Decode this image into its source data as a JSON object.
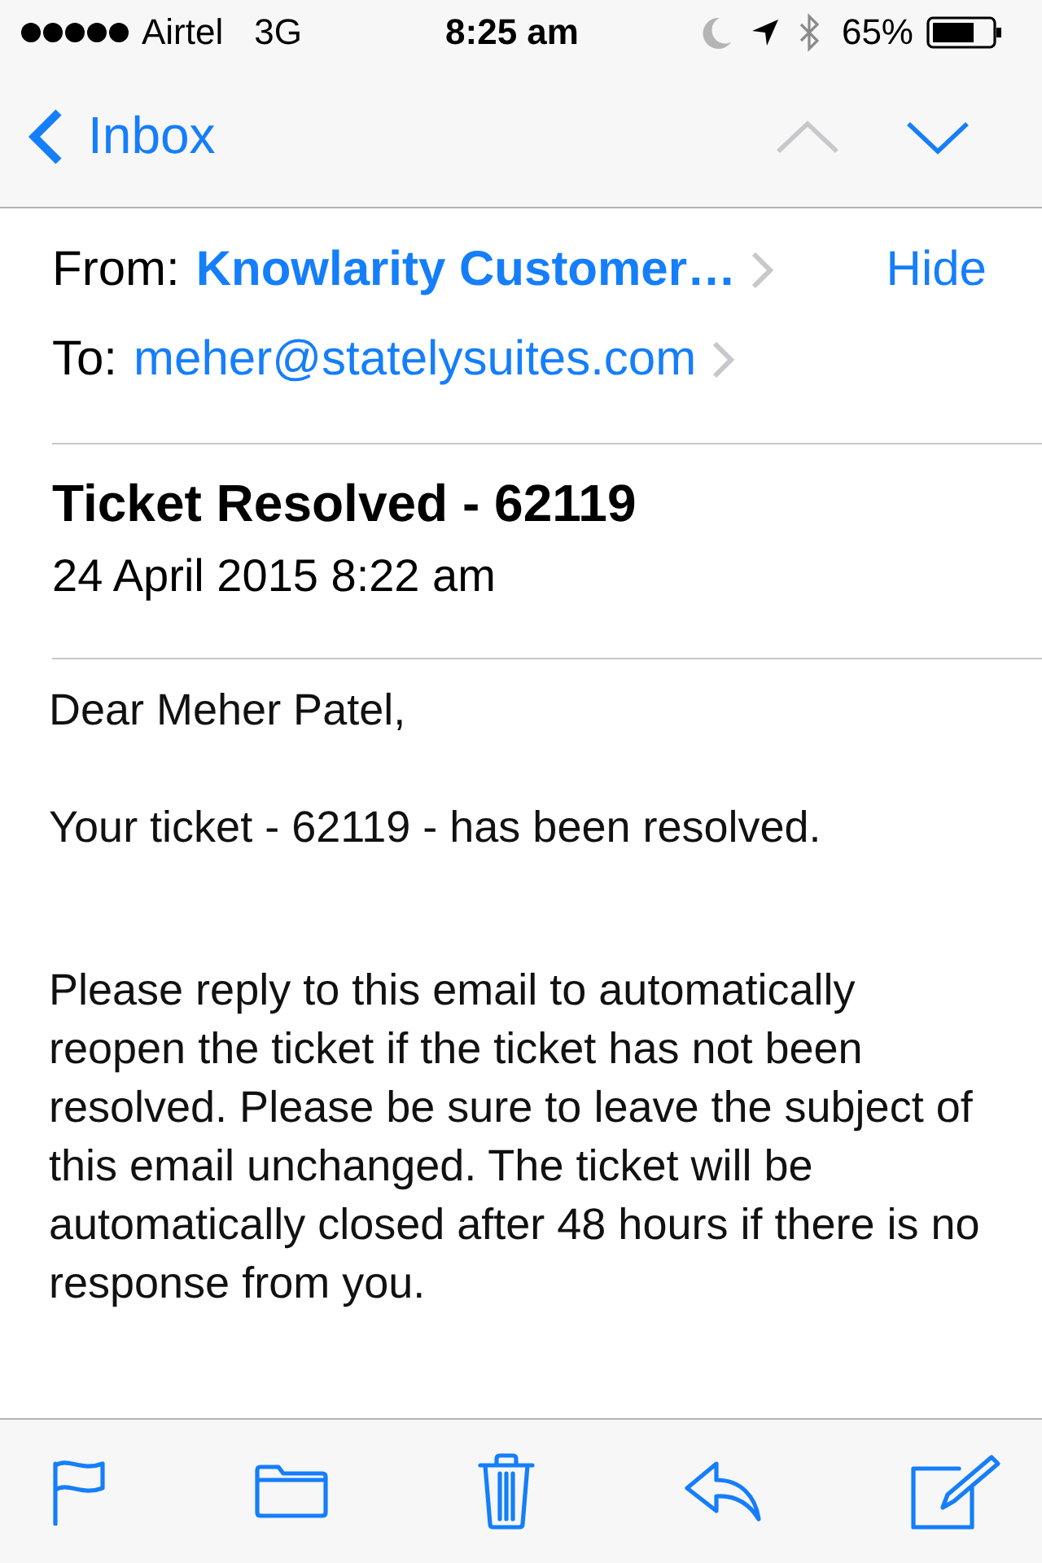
{
  "status_bar": {
    "carrier": "Airtel",
    "network": "3G",
    "time": "8:25 am",
    "battery_percent": "65%"
  },
  "nav_bar": {
    "back_label": "Inbox",
    "message_arrows": [
      {
        "kind": "up",
        "disabled": true
      },
      {
        "kind": "down",
        "disabled": false
      }
    ]
  },
  "header": {
    "from_label": "From:",
    "sender": "Knowlarity Customer…",
    "hide_label": "Hide",
    "to_label": "To:",
    "recipient": "meher@statelysuites.com",
    "subject": "Ticket Resolved - 62119",
    "date": "24 April 2015 8:22 am"
  },
  "body": {
    "paragraphs": [
      "Dear Meher Patel,",
      "Your ticket - 62119 - has been resolved.",
      "Please reply to this email to automatically reopen the ticket if the ticket has not been resolved. Please be sure to leave the subject of this email unchanged. The ticket will be automatically closed after 48 hours if there is no response from you."
    ]
  },
  "toolbar": {
    "actions": [
      {
        "kind": "flag"
      },
      {
        "kind": "folder"
      },
      {
        "kind": "trash"
      },
      {
        "kind": "reply"
      },
      {
        "kind": "compose"
      }
    ]
  }
}
